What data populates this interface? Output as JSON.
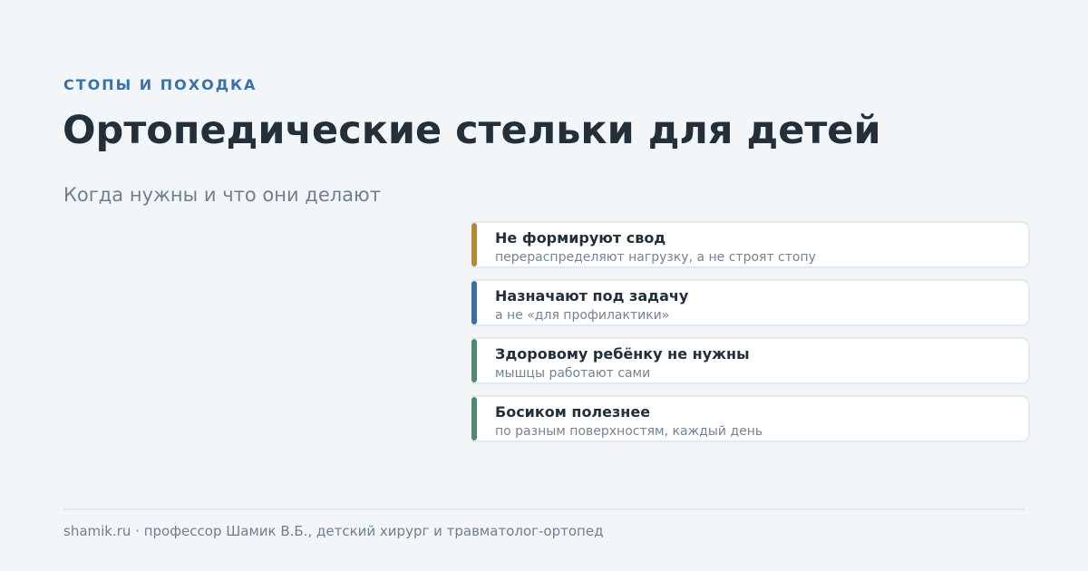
{
  "header": {
    "eyebrow": "СТОПЫ И ПОХОДКА",
    "title": "Ортопедические стельки для детей",
    "subtitle": "Когда нужны и что они делают"
  },
  "cards": [
    {
      "title": "Не формируют свод",
      "subtitle": "перераспределяют нагрузку, а не строят стопу",
      "accent": "#b5883a"
    },
    {
      "title": "Назначают под задачу",
      "subtitle": "а не «для профилактики»",
      "accent": "#3a6ea8"
    },
    {
      "title": "Здоровому ребёнку не нужны",
      "subtitle": "мышцы работают сами",
      "accent": "#4e8a6c"
    },
    {
      "title": "Босиком полезнее",
      "subtitle": "по разным поверхностям, каждый день",
      "accent": "#4e8a6c"
    }
  ],
  "footer": {
    "text": "shamik.ru · профессор Шамик В.Б., детский хирург и травматолог-ортопед"
  }
}
